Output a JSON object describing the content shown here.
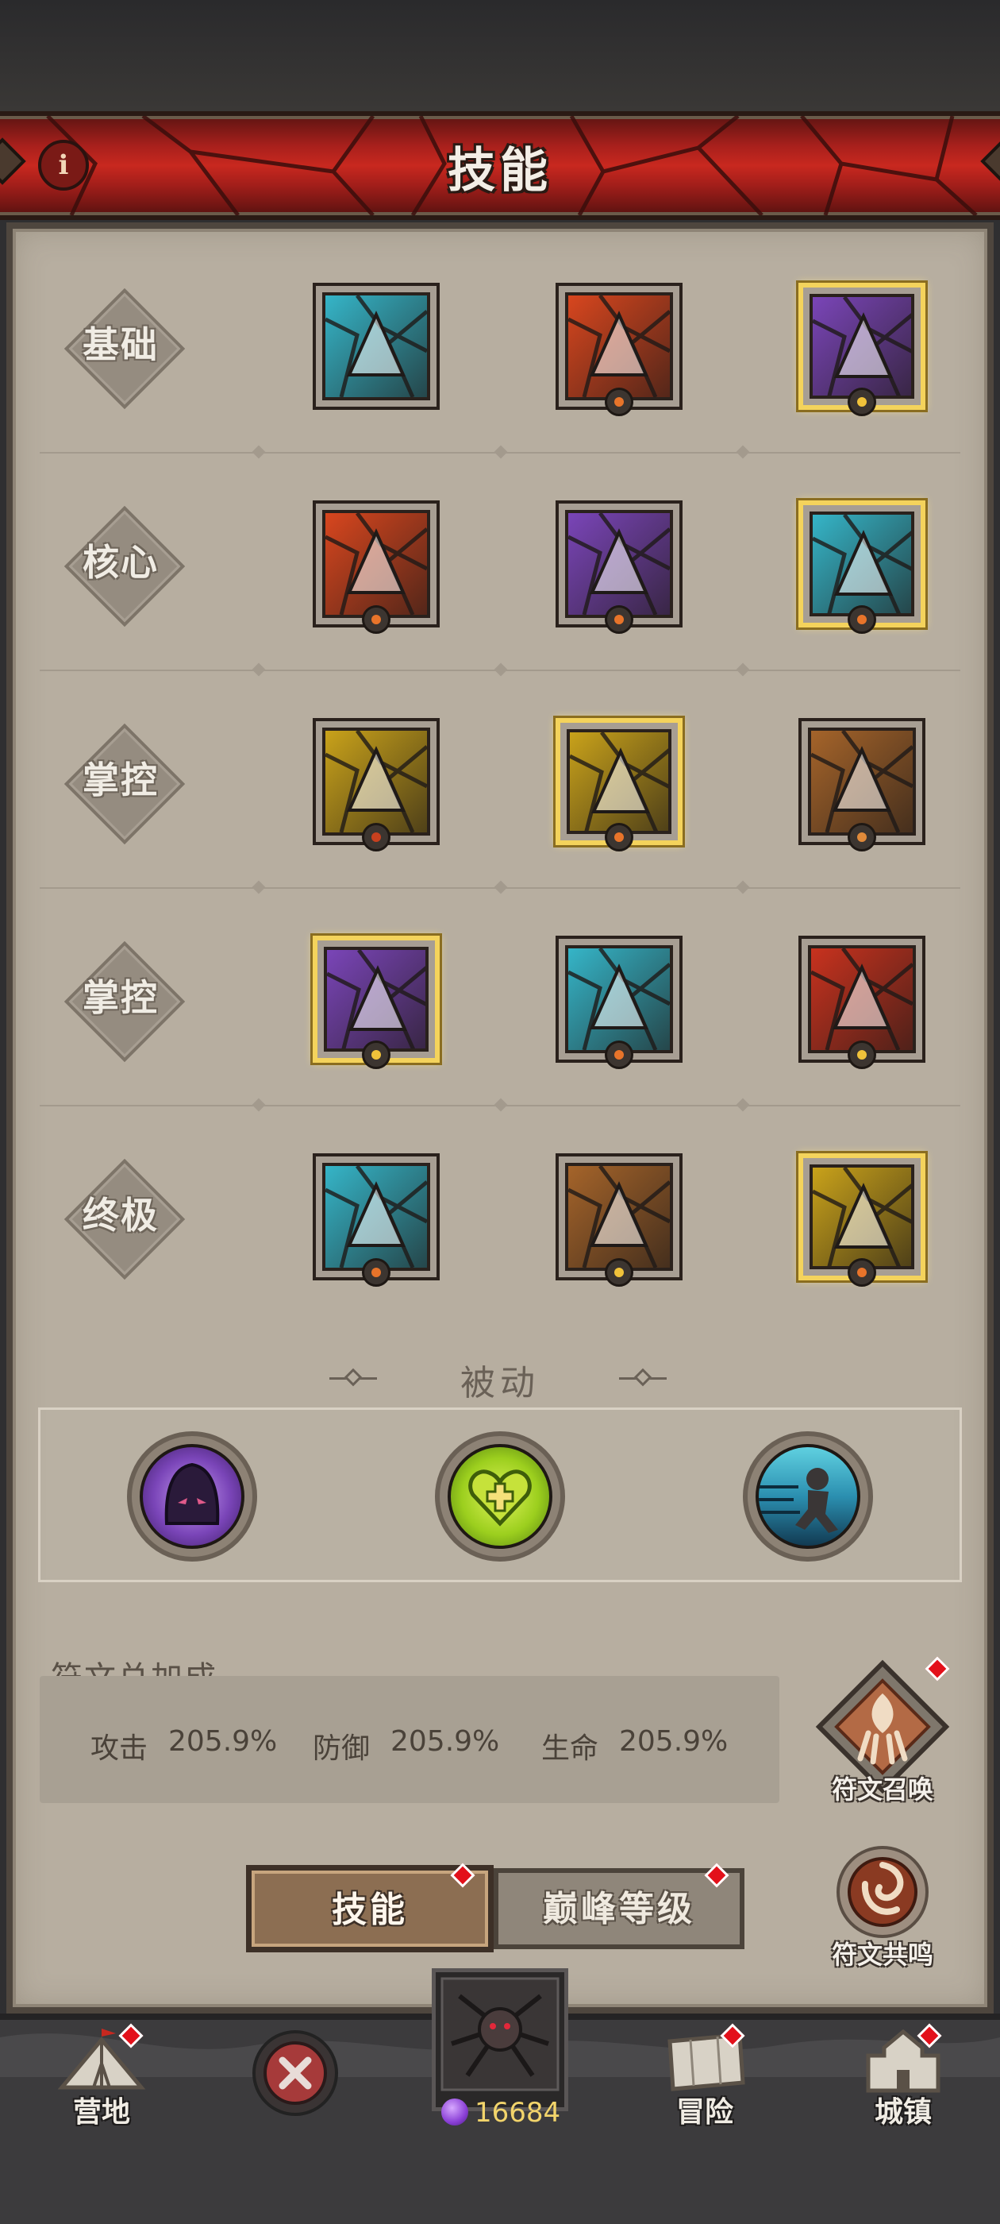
{
  "header": {
    "title": "技能",
    "info_icon": "info-icon"
  },
  "skill_rows": [
    {
      "label": "基础",
      "skills": [
        {
          "icon": "ice-arrow-skill-icon",
          "gold": false,
          "rune": false,
          "color": "#35b5c8"
        },
        {
          "icon": "fire-claw-skill-icon",
          "gold": false,
          "rune": true,
          "rune_color": "#e8742a",
          "color": "#d8461e"
        },
        {
          "icon": "lightning-bolt-skill-icon",
          "gold": true,
          "rune": true,
          "rune_color": "#f0c23a",
          "color": "#7a45b8"
        }
      ]
    },
    {
      "label": "核心",
      "skills": [
        {
          "icon": "fireball-skill-icon",
          "gold": false,
          "rune": true,
          "rune_color": "#e8742a",
          "color": "#d8461e"
        },
        {
          "icon": "thunder-fist-skill-icon",
          "gold": false,
          "rune": true,
          "rune_color": "#e8742a",
          "color": "#7a45b8"
        },
        {
          "icon": "ice-shards-skill-icon",
          "gold": true,
          "rune": true,
          "rune_color": "#e8742a",
          "color": "#35b5c8"
        }
      ]
    },
    {
      "label": "掌控",
      "skills": [
        {
          "icon": "golden-crown-spikes-skill-icon",
          "gold": false,
          "rune": true,
          "rune_color": "#c8401e",
          "color": "#c9a21a"
        },
        {
          "icon": "golden-golem-skill-icon",
          "gold": true,
          "rune": true,
          "rune_color": "#e8742a",
          "color": "#c9a21a"
        },
        {
          "icon": "meteor-skill-icon",
          "gold": false,
          "rune": true,
          "rune_color": "#e08a3a",
          "color": "#a5642a"
        }
      ]
    },
    {
      "label": "掌控",
      "skills": [
        {
          "icon": "lightning-orb-skill-icon",
          "gold": true,
          "rune": true,
          "rune_color": "#f0c23a",
          "color": "#7a45b8"
        },
        {
          "icon": "snowflake-skill-icon",
          "gold": false,
          "rune": true,
          "rune_color": "#e8742a",
          "color": "#35b5c8"
        },
        {
          "icon": "fire-beast-skill-icon",
          "gold": false,
          "rune": true,
          "rune_color": "#f0c23a",
          "color": "#c8321e"
        }
      ]
    },
    {
      "label": "终极",
      "skills": [
        {
          "icon": "blizzard-vortex-skill-icon",
          "gold": false,
          "rune": true,
          "rune_color": "#e8742a",
          "color": "#35b5c8"
        },
        {
          "icon": "summon-clones-skill-icon",
          "gold": false,
          "rune": true,
          "rune_color": "#f0c23a",
          "color": "#a5642a"
        },
        {
          "icon": "golden-avatar-skill-icon",
          "gold": true,
          "rune": true,
          "rune_color": "#e8742a",
          "color": "#c9a21a"
        }
      ]
    }
  ],
  "passive": {
    "title": "被动",
    "skills": [
      {
        "icon": "hooded-shadow-passive-icon",
        "color": "#7a45b8"
      },
      {
        "icon": "heart-shield-passive-icon",
        "color": "#9ccf1e"
      },
      {
        "icon": "dash-runner-passive-icon",
        "color": "#35b5c8"
      }
    ]
  },
  "rune_bonus": {
    "title": "符文总加成",
    "attack_label": "攻击",
    "attack_value": "205.9%",
    "defense_label": "防御",
    "defense_value": "205.9%",
    "hp_label": "生命",
    "hp_value": "205.9%"
  },
  "side_buttons": {
    "summon_label": "符文召唤",
    "resonance_label": "符文共鸣"
  },
  "tabs": {
    "active": "技能",
    "inactive": "巅峰等级"
  },
  "bottom_nav": {
    "camp": "营地",
    "adventure": "冒险",
    "town": "城镇",
    "currency": "16684"
  },
  "colors": {
    "banner_red": "#c8281f",
    "panel_bg": "#b7aea0",
    "gold_frame": "#f4d35c",
    "notification_red": "#e3101a"
  }
}
